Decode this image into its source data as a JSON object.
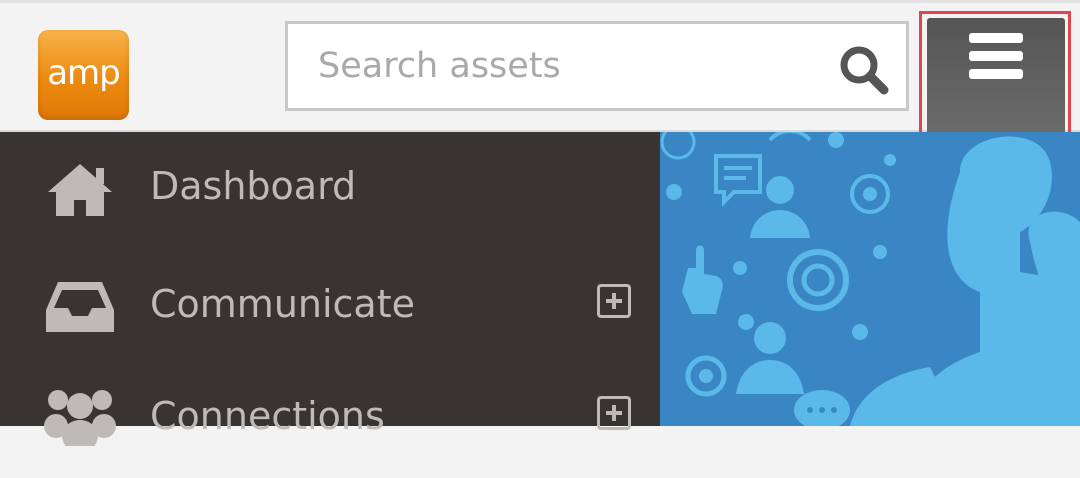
{
  "header": {
    "logo_text": "amp",
    "search": {
      "placeholder": "Search assets",
      "value": ""
    },
    "icons": {
      "search": "search-icon",
      "menu": "hamburger-menu-icon"
    }
  },
  "sidebar": {
    "items": [
      {
        "label": "Dashboard",
        "icon": "home-icon",
        "expandable": false
      },
      {
        "label": "Communicate",
        "icon": "inbox-icon",
        "expandable": true
      },
      {
        "label": "Connections",
        "icon": "group-icon",
        "expandable": true
      }
    ]
  },
  "colors": {
    "topbar": "#f3f3f3",
    "sidebar": "#383432",
    "sidebar_text": "#bdbab7",
    "logo_orange": "#ec8a10",
    "menu_button": "#5f5f5f",
    "highlight": "#e0474c",
    "hero_blue": "#3a86c4",
    "hero_light_blue": "#5ab9e8"
  }
}
